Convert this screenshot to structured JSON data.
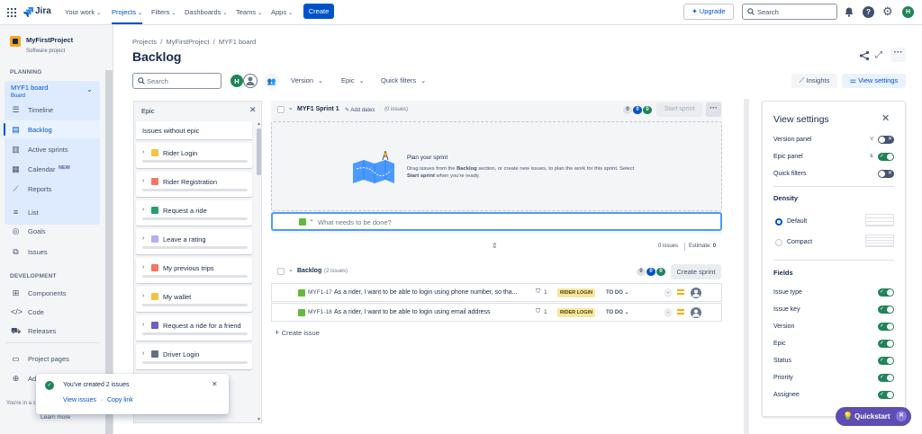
{
  "topnav": {
    "logo_text": "Jira",
    "items": [
      "Your work",
      "Projects",
      "Filters",
      "Dashboards",
      "Teams",
      "Apps"
    ],
    "create_label": "Create",
    "upgrade_label": "Upgrade",
    "search_placeholder": "Search",
    "avatar_initial": "H"
  },
  "sidebar": {
    "project_name": "MyFirstProject",
    "project_type": "Software project",
    "planning_heading": "PLANNING",
    "board_name": "MYF1 board",
    "board_sub": "Board",
    "planning_items": [
      "Timeline",
      "Backlog",
      "Active sprints",
      "Calendar",
      "Reports"
    ],
    "calendar_badge": "NEW",
    "other_items": [
      "List",
      "Goals",
      "Issues"
    ],
    "development_heading": "DEVELOPMENT",
    "dev_items": [
      "Components",
      "Code",
      "Releases"
    ],
    "bottom_items": [
      "Project pages",
      "Add"
    ],
    "footer_text": "You're in a c",
    "learn_more": "Learn more"
  },
  "breadcrumb": [
    "Projects",
    "/",
    "MyFirstProject",
    "/",
    "MYF1 board"
  ],
  "page_title": "Backlog",
  "toolbar": {
    "search_placeholder": "Search",
    "avatar_initial": "H",
    "filters": [
      "Version",
      "Epic",
      "Quick filters"
    ],
    "insights_label": "Insights",
    "view_settings_label": "View settings"
  },
  "epic_panel": {
    "title": "Epic",
    "issues_without_epic": "Issues without epic",
    "epics": [
      {
        "name": "Rider Login",
        "color": "#f5c343"
      },
      {
        "name": "Rider Registration",
        "color": "#f87462"
      },
      {
        "name": "Request a ride",
        "color": "#22a06b"
      },
      {
        "name": "Leave a rating",
        "color": "#b8acf6"
      },
      {
        "name": "My previous trips",
        "color": "#f87462"
      },
      {
        "name": "My wallet",
        "color": "#f5c343"
      },
      {
        "name": "Request a ride for a friend",
        "color": "#6e5dc6"
      },
      {
        "name": "Driver Login",
        "color": "#626f86"
      }
    ]
  },
  "sprint": {
    "name": "MYF1 Sprint 1",
    "add_dates": "Add dates",
    "issue_count": "(0 issues)",
    "counts": [
      "0",
      "0",
      "0"
    ],
    "start_label": "Start sprint",
    "empty_title": "Plan your sprint",
    "empty_line1_a": "Drag issues from the ",
    "empty_line1_b": "Backlog",
    "empty_line1_c": " section, or create new issues, to plan the work for this sprint. Select",
    "empty_line2_a": "Start sprint",
    "empty_line2_b": " when you're ready.",
    "input_placeholder": "What needs to be done?",
    "footer_issues": "0 issues",
    "estimate_label": "Estimate:",
    "estimate_value": "0"
  },
  "backlog": {
    "name": "Backlog",
    "issue_count": "(2 issues)",
    "counts": [
      "0",
      "0",
      "0"
    ],
    "create_sprint_label": "Create sprint",
    "issues": [
      {
        "key": "MYF1-17",
        "summary": "As a rider, I want to be able to login using phone number, so tha...",
        "stat": "1",
        "epic": "RIDER LOGIN",
        "status": "TO DO",
        "estimate": "-"
      },
      {
        "key": "MYF1-18",
        "summary": "As a rider, I want to be able to login using email address",
        "stat": "1",
        "epic": "RIDER LOGIN",
        "status": "TO DO",
        "estimate": "-"
      }
    ],
    "create_issue_label": "Create issue"
  },
  "view_settings": {
    "title": "View settings",
    "panels": [
      {
        "label": "Version panel",
        "key": "V",
        "on": false
      },
      {
        "label": "Epic panel",
        "key": "E",
        "on": true
      },
      {
        "label": "Quick filters",
        "key": "",
        "on": false
      }
    ],
    "density_heading": "Density",
    "density_options": [
      "Default",
      "Compact"
    ],
    "fields_heading": "Fields",
    "fields": [
      "Issue type",
      "Issue key",
      "Version",
      "Epic",
      "Status",
      "Priority",
      "Assignee"
    ]
  },
  "toast": {
    "message": "You've created 2 issues",
    "view_issues": "View issues",
    "separator": "·",
    "copy_link": "Copy link"
  },
  "quickstart_label": "Quickstart",
  "colors": {
    "brand_blue": "#0052cc",
    "selection_bg": "#e9f2ff",
    "toggle_on": "#1f845a",
    "quickstart": "#5e4db2"
  }
}
